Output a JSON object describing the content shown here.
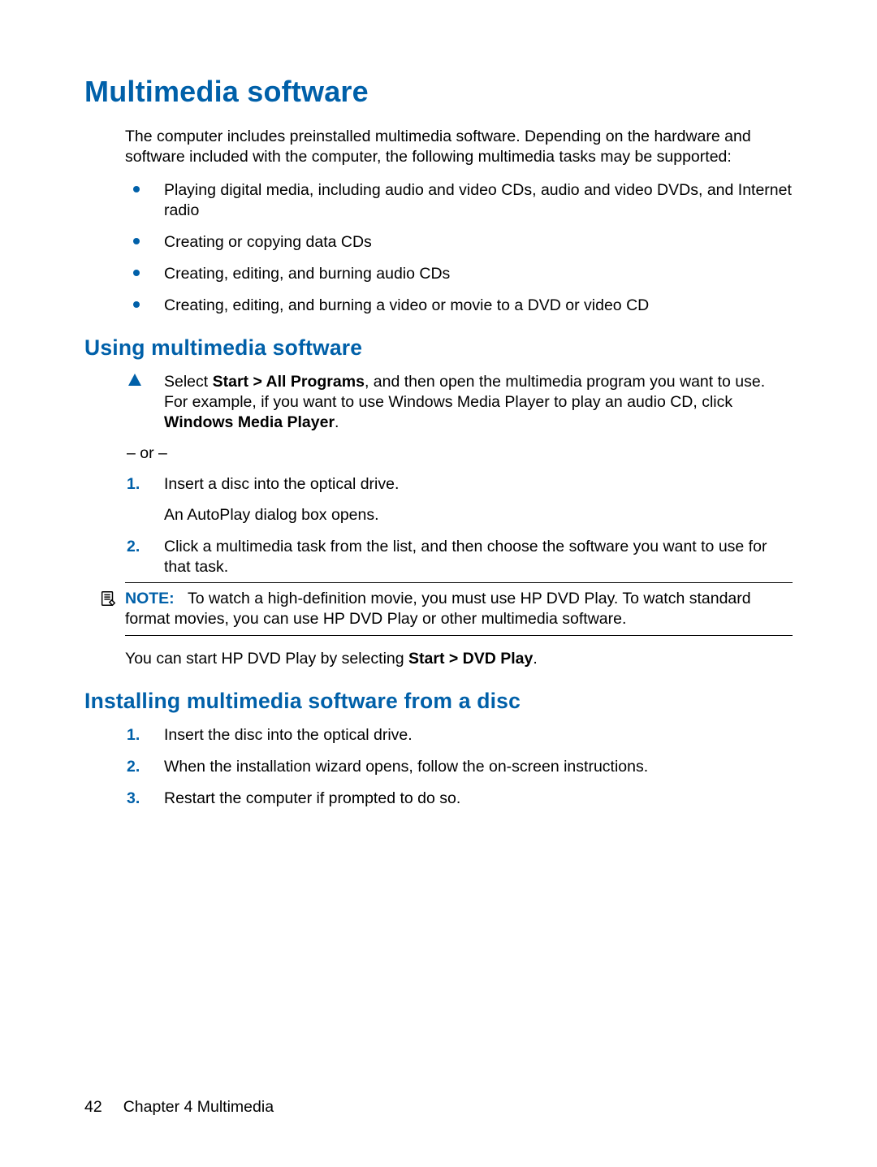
{
  "h1": "Multimedia software",
  "intro": "The computer includes preinstalled multimedia software. Depending on the hardware and software included with the computer, the following multimedia tasks may be supported:",
  "bullets": [
    "Playing digital media, including audio and video CDs, audio and video DVDs, and Internet radio",
    "Creating or copying data CDs",
    "Creating, editing, and burning audio CDs",
    "Creating, editing, and burning a video or movie to a DVD or video CD"
  ],
  "sectionA": {
    "title": "Using multimedia software",
    "triangleStep": {
      "pre": "Select ",
      "bold1": "Start > All Programs",
      "mid": ", and then open the multimedia program you want to use. For example, if you want to use Windows Media Player to play an audio CD, click ",
      "bold2": "Windows Media Player",
      "post": "."
    },
    "or": "– or –",
    "steps": [
      {
        "num": "1.",
        "text": "Insert a disc into the optical drive.",
        "sub": "An AutoPlay dialog box opens."
      },
      {
        "num": "2.",
        "text": "Click a multimedia task from the list, and then choose the software you want to use for that task."
      }
    ],
    "note": {
      "label": "NOTE:",
      "text": "To watch a high-definition movie, you must use HP DVD Play. To watch standard format movies, you can use HP DVD Play or other multimedia software."
    },
    "after": {
      "pre": "You can start HP DVD Play by selecting ",
      "bold": "Start > DVD Play",
      "post": "."
    }
  },
  "sectionB": {
    "title": "Installing multimedia software from a disc",
    "steps": [
      {
        "num": "1.",
        "text": "Insert the disc into the optical drive."
      },
      {
        "num": "2.",
        "text": "When the installation wizard opens, follow the on-screen instructions."
      },
      {
        "num": "3.",
        "text": "Restart the computer if prompted to do so."
      }
    ]
  },
  "footer": {
    "page": "42",
    "chapter": "Chapter 4   Multimedia"
  }
}
